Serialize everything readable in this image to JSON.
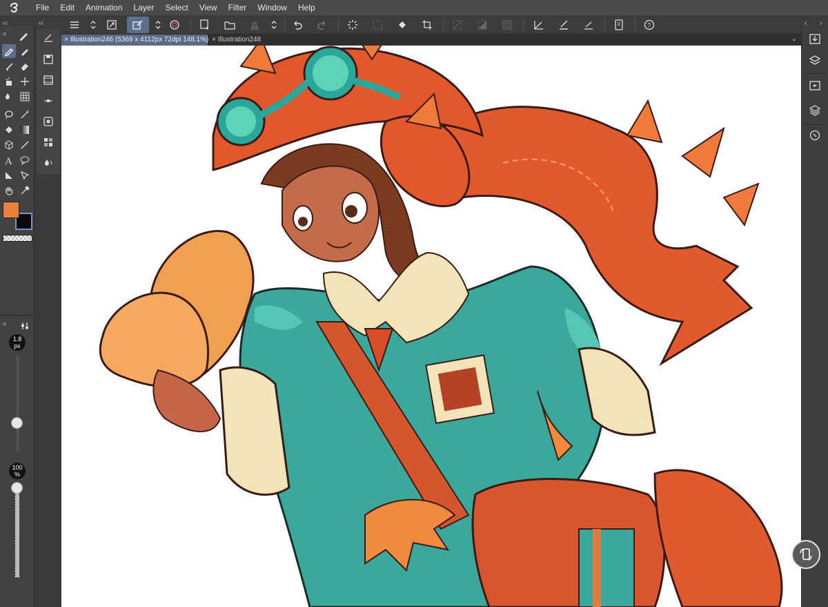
{
  "menu": {
    "items": [
      "File",
      "Edit",
      "Animation",
      "Layer",
      "Select",
      "View",
      "Filter",
      "Window",
      "Help"
    ]
  },
  "tabs": [
    {
      "label": "Illustration246 (5369 x 4112px 72dpi 148.1%)",
      "active": true
    },
    {
      "label": "Illustration248",
      "active": false
    }
  ],
  "brush": {
    "size_value": "1.8",
    "size_unit": "px",
    "opacity_value": "100",
    "opacity_unit": "%"
  },
  "colors": {
    "main_color": "#e8823a",
    "sub_color": "#0a0a0a",
    "accent": "#5d6f8e"
  },
  "toolbar_icons": [
    "menu-icon",
    "up-down-icon",
    "resize-icon",
    "edit-icon",
    "up-down-icon",
    "swirl-icon",
    "new-layer-icon",
    "open-folder-icon",
    "stamp-icon",
    "up-down-icon",
    "undo-icon",
    "redo-icon",
    "loading-icon",
    "grid-icon",
    "fill-icon",
    "crop-icon",
    "select-all-icon",
    "invert-icon",
    "clear-icon",
    "ruler-icon",
    "brush-icon",
    "line-icon",
    "tablet-icon",
    "help-icon"
  ],
  "right_icons": [
    "import-icon",
    "layers-icon",
    "animation-icon",
    "stack-icon",
    "search-icon"
  ]
}
